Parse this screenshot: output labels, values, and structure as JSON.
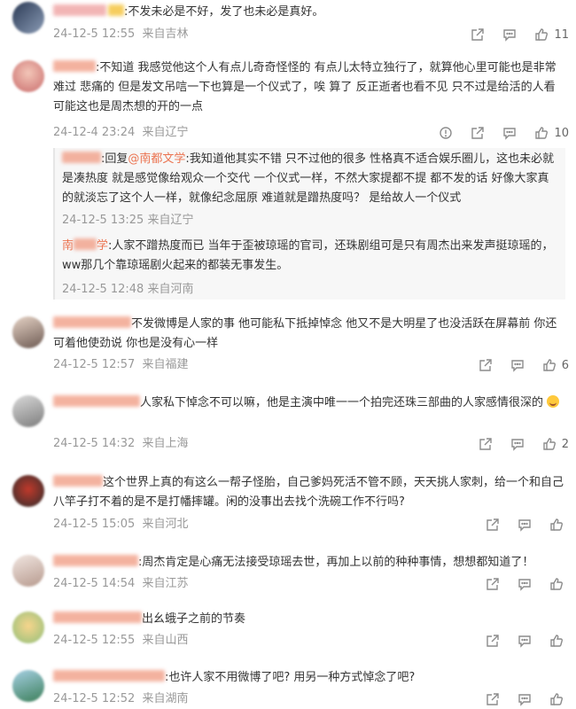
{
  "icons": {
    "share": "share-icon",
    "comment": "comment-icon",
    "like": "like-icon",
    "report": "report-icon"
  },
  "colors": {
    "mention": "#eb7350",
    "meta": "#999999"
  },
  "comments": [
    {
      "text": "不发未必是不好，发了也未必是真好。",
      "date": "24-12-5 12:55",
      "location": "来自吉林",
      "likes": "11"
    },
    {
      "text": "不知道 我感觉他这个人有点儿奇奇怪怪的 有点儿太特立独行了，就算他心里可能也是非常难过 悲痛的 但是发文吊唁一下也算是一个仪式了，唉 算了 反正逝者也看不见 只不过是给活的人看 可能这也是周杰想的开的一点",
      "date": "24-12-4 23:24",
      "location": "来自辽宁",
      "likes": "10",
      "replies": [
        {
          "prefix": "回复",
          "mention": "@南都文学",
          "text": "我知道他其实不错 只不过他的很多 性格真不适合娱乐圈儿，这也未必就是凑热度 就是感觉像给观众一个交代 一个仪式一样，不然大家提都不提 都不发的话 好像大家真的就淡忘了这个人一样，就像纪念屈原 难道就是蹭热度吗？ 是给故人一个仪式",
          "date": "24-12-5 13:25",
          "location": "来自辽宁"
        },
        {
          "name_visible": "南",
          "name_tail": "学",
          "text": "人家不蹭热度而已 当年于歪被琼瑶的官司，还珠剧组可是只有周杰出来发声挺琼瑶的，ww那几个靠琼瑶剧火起来的都装无事发生。",
          "date": "24-12-5 12:48",
          "location": "来自河南"
        }
      ]
    },
    {
      "text": "不发微博是人家的事  他可能私下抵掉悼念 他又不是大明星了也没活跃在屏幕前 你还可着他使劲说  你也是没有心一样",
      "date": "24-12-5 12:57",
      "location": "来自福建",
      "likes": "6"
    },
    {
      "text": "人家私下悼念不可以嘛，他是主演中唯一一个拍完还珠三部曲的人家感情很深的",
      "date": "24-12-5 14:32",
      "location": "来自上海",
      "likes": "2"
    },
    {
      "text": "这个世界上真的有这么一帮子怪胎，自己爹妈死活不管不顾，天天挑人家刺，给一个和自己八竿子打不着的是不是打幡摔罐。闲的没事出去找个洗碗工作不行吗?",
      "date": "24-12-5 15:05",
      "location": "来自河北",
      "likes": ""
    },
    {
      "text": "周杰肯定是心痛无法接受琼瑶去世，再加上以前的种种事情，想想都知道了！",
      "date": "24-12-5 14:54",
      "location": "来自江苏",
      "likes": ""
    },
    {
      "text": "出幺蛾子之前的节奏",
      "date": "24-12-5 12:55",
      "location": "来自山西",
      "likes": ""
    },
    {
      "text": "也许人家不用微博了吧? 用另一种方式悼念了吧?",
      "date": "24-12-5 12:52",
      "location": "来自湖南",
      "likes": ""
    }
  ]
}
